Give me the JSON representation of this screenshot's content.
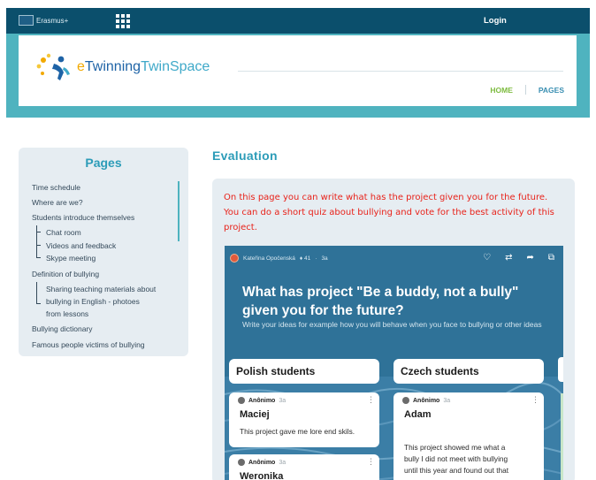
{
  "topbar": {
    "brand": "Erasmus+",
    "apps_icon": "grid-icon",
    "login": "Login"
  },
  "header": {
    "brand_e": "e",
    "brand_twinning": "Twinning",
    "brand_twinspace": "TwinSpace",
    "nav": {
      "home": "HOME",
      "pages": "PAGES"
    },
    "colors": {
      "bar": "#0b4f6c",
      "band": "#4fb3bf",
      "home": "#7dbb3f",
      "accent": "#2c9cb8"
    }
  },
  "sidebar": {
    "title": "Pages",
    "items": [
      "Time schedule",
      "Where are we?",
      "Students introduce themselves",
      "Definition of bullying",
      "Bullying dictionary",
      "Famous people victims of bullying"
    ],
    "sub_students": [
      "Chat room",
      "Videos and feedback",
      "Skype meeting"
    ],
    "sub_definition": [
      "Sharing teaching materials about",
      "bullying in English - photoes",
      "from lessons"
    ]
  },
  "main": {
    "title": "Evaluation",
    "intro": "On this page you can write what has the project given you for the future. You can do a short quiz about bullying and vote for the best activity of this project."
  },
  "padlet": {
    "author": "Kateřina Opočenská",
    "likes": "♦ 41",
    "age": "3a",
    "dot": "·",
    "icons": [
      "heart-icon",
      "remake-icon",
      "share-icon",
      "open-external-icon"
    ],
    "title": "What has project \"Be a buddy, not a bully\" given you for the future?",
    "description": "Write your ideas for example how you will behave when you face to bullying or other ideas",
    "columns": [
      {
        "header": "Polish students",
        "posts": [
          {
            "author": "Anônimo",
            "age": "3a",
            "name": "Maciej",
            "body": "This project gave me lore end skils."
          },
          {
            "author": "Anônimo",
            "age": "3a",
            "name": "Weronika",
            "body": ""
          }
        ]
      },
      {
        "header": "Czech students",
        "posts": [
          {
            "author": "Anônimo",
            "age": "3a",
            "name": "Adam",
            "body_lines": [
              "This project showed me what a",
              "bully I did not meet with bullying",
              "until this year and found out that"
            ]
          }
        ]
      }
    ]
  }
}
